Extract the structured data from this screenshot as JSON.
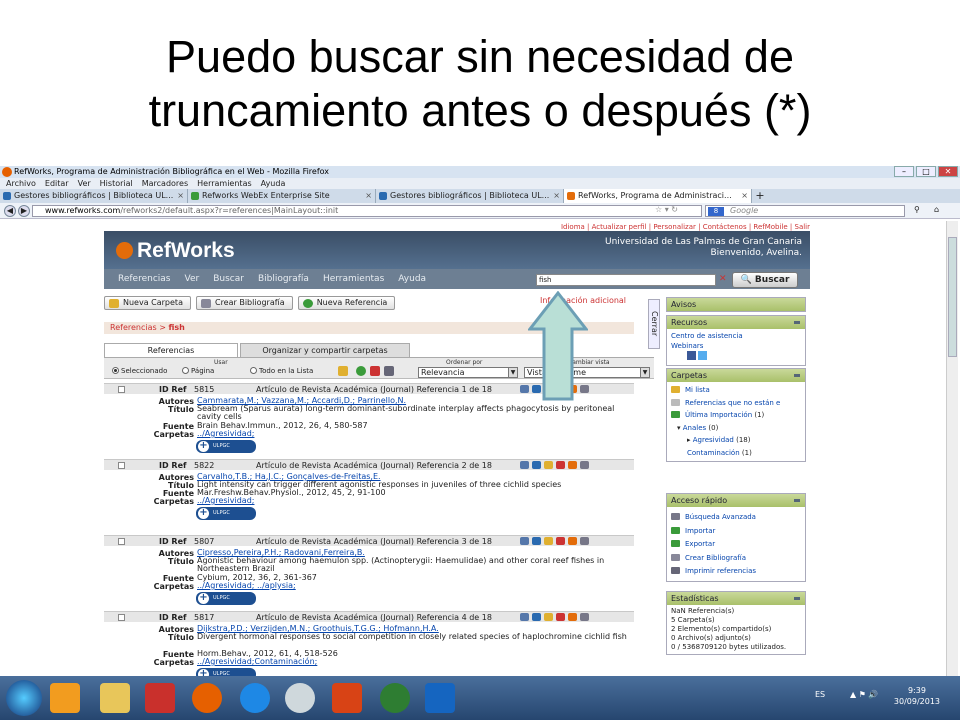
{
  "slide": {
    "title_line1": "Puedo buscar sin necesidad de",
    "title_line2": "truncamiento antes o después (*)"
  },
  "window": {
    "title": "RefWorks, Programa de Administración Bibliográfica en el Web - Mozilla Firefox"
  },
  "menu": [
    "Archivo",
    "Editar",
    "Ver",
    "Historial",
    "Marcadores",
    "Herramientas",
    "Ayuda"
  ],
  "tabs": [
    {
      "label": "Gestores bibliográficos | Biblioteca UL..."
    },
    {
      "label": "Refworks WebEx Enterprise Site"
    },
    {
      "label": "Gestores bibliográficos | Biblioteca UL..."
    },
    {
      "label": "RefWorks, Programa de Administraci..."
    }
  ],
  "newtab": "+",
  "address": {
    "host": "www.refworks.com",
    "path": "/refworks2/default.aspx?r=references|MainLayout::init"
  },
  "google": {
    "badge": "8",
    "placeholder": "Google"
  },
  "rw": {
    "toplinks": "Idioma | Actualizar perfil | Personalizar | Contáctenos | RefMobile | Salir",
    "logo": "RefWorks",
    "univ": "Universidad de Las Palmas de Gran Canaria",
    "welcome": "Bienvenido, Avelina.",
    "nav": [
      "Referencias",
      "Ver",
      "Buscar",
      "Bibliografía",
      "Herramientas",
      "Ayuda"
    ],
    "search_value": "fish",
    "search_button": "Buscar",
    "buttons": [
      "Nueva Carpeta",
      "Crear Bibliografía",
      "Nueva Referencia"
    ],
    "adv_info": "Información adicional",
    "crumb": {
      "root": "Referencias",
      "sep": ">",
      "term": "fish"
    },
    "panel_tabs": [
      "Referencias",
      "Organizar y compartir carpetas"
    ],
    "usar": "Usar",
    "radios": [
      "Seleccionado",
      "Página",
      "Todo en la Lista"
    ],
    "ordenar_label": "Ordenar por",
    "ordenar_value": "Relevancia",
    "vista_label": "Cambiar vista",
    "vista_value": "Vista Uniforme",
    "close": "Cerrar"
  },
  "records": [
    {
      "id": "5815",
      "type": "Artículo de Revista Académica (Journal) Referencia 1 de 18",
      "autores": "Cammarata,M.; Vazzana,M.; Accardi,D.; Parrinello,N.",
      "titulo": "Seabream (Sparus aurata) long-term dominant-subordinate interplay affects phagocytosis by peritoneal cavity cells",
      "fuente": "Brain Behav.Immun., 2012, 26, 4, 580-587",
      "carpetas": "../Agresividad;"
    },
    {
      "id": "5822",
      "type": "Artículo de Revista Académica (Journal) Referencia 2 de 18",
      "autores": "Carvalho,T.B.; Ha,J.C.; Gonçalves-de-Freitas,E.",
      "titulo": "Light intensity can trigger different agonistic responses in juveniles of three cichlid species",
      "fuente": "Mar.Freshw.Behav.Physiol., 2012, 45, 2, 91-100",
      "carpetas": "../Agresividad;"
    },
    {
      "id": "5807",
      "type": "Artículo de Revista Académica (Journal) Referencia 3 de 18",
      "autores": "Cipresso,Pereira,P.H.; Radovani,Ferreira,B.",
      "titulo": "Agonistic behaviour among haemulon spp. (Actinopterygii: Haemulidae) and other coral reef fishes in Northeastern Brazil",
      "fuente": "Cybium, 2012, 36, 2, 361-367",
      "carpetas": "../Agresividad; ../aplysia;"
    },
    {
      "id": "5817",
      "type": "Artículo de Revista Académica (Journal) Referencia 4 de 18",
      "autores": "Dijkstra,P.D.; Verzijden,M.N.; Groothuis,T.G.G.; Hofmann,H.A.",
      "titulo": "Divergent hormonal responses to social competition in closely related species of haplochromine cichlid fish",
      "fuente": "Horm.Behav., 2012, 61, 4, 518-526",
      "carpetas": "../Agresividad;Contaminación;"
    }
  ],
  "labels": {
    "idref": "ID Ref",
    "autores": "Autores",
    "titulo": "Título",
    "fuente": "Fuente",
    "carpetas": "Carpetas",
    "ulpgc": "ULPGC"
  },
  "sidebar": {
    "avisos": "Avisos",
    "recursos": "Recursos",
    "recursos_items": [
      "Centro de asistencia",
      "Webinars"
    ],
    "carpetas": "Carpetas",
    "carpetas_items": [
      {
        "label": "Mi lista",
        "count": ""
      },
      {
        "label": "Referencias que no están e",
        "count": ""
      },
      {
        "label": "Última Importación",
        "count": "(1)"
      },
      {
        "label": "Anales",
        "count": "(0)"
      },
      {
        "label": "Agresividad",
        "count": "(18)"
      },
      {
        "label": "Contaminación",
        "count": "(1)"
      }
    ],
    "acceso": "Acceso rápido",
    "acceso_items": [
      "Búsqueda Avanzada",
      "Importar",
      "Exportar",
      "Crear Bibliografía",
      "Imprimir referencias"
    ],
    "estadisticas": "Estadísticas",
    "stats": [
      "NaN Referencia(s)",
      "5 Carpeta(s)",
      "2 Elemento(s) compartido(s)",
      "0 Archivo(s) adjunto(s)",
      "0 / 5368709120 bytes utilizados."
    ]
  },
  "taskbar": {
    "lang": "ES",
    "time": "9:39",
    "date": "30/09/2013"
  },
  "colors": {
    "accent": "#e36c0a",
    "header": "#3a4e66",
    "link": "#0645ad",
    "red": "#c33333",
    "panel_green": "#a9c06a"
  }
}
